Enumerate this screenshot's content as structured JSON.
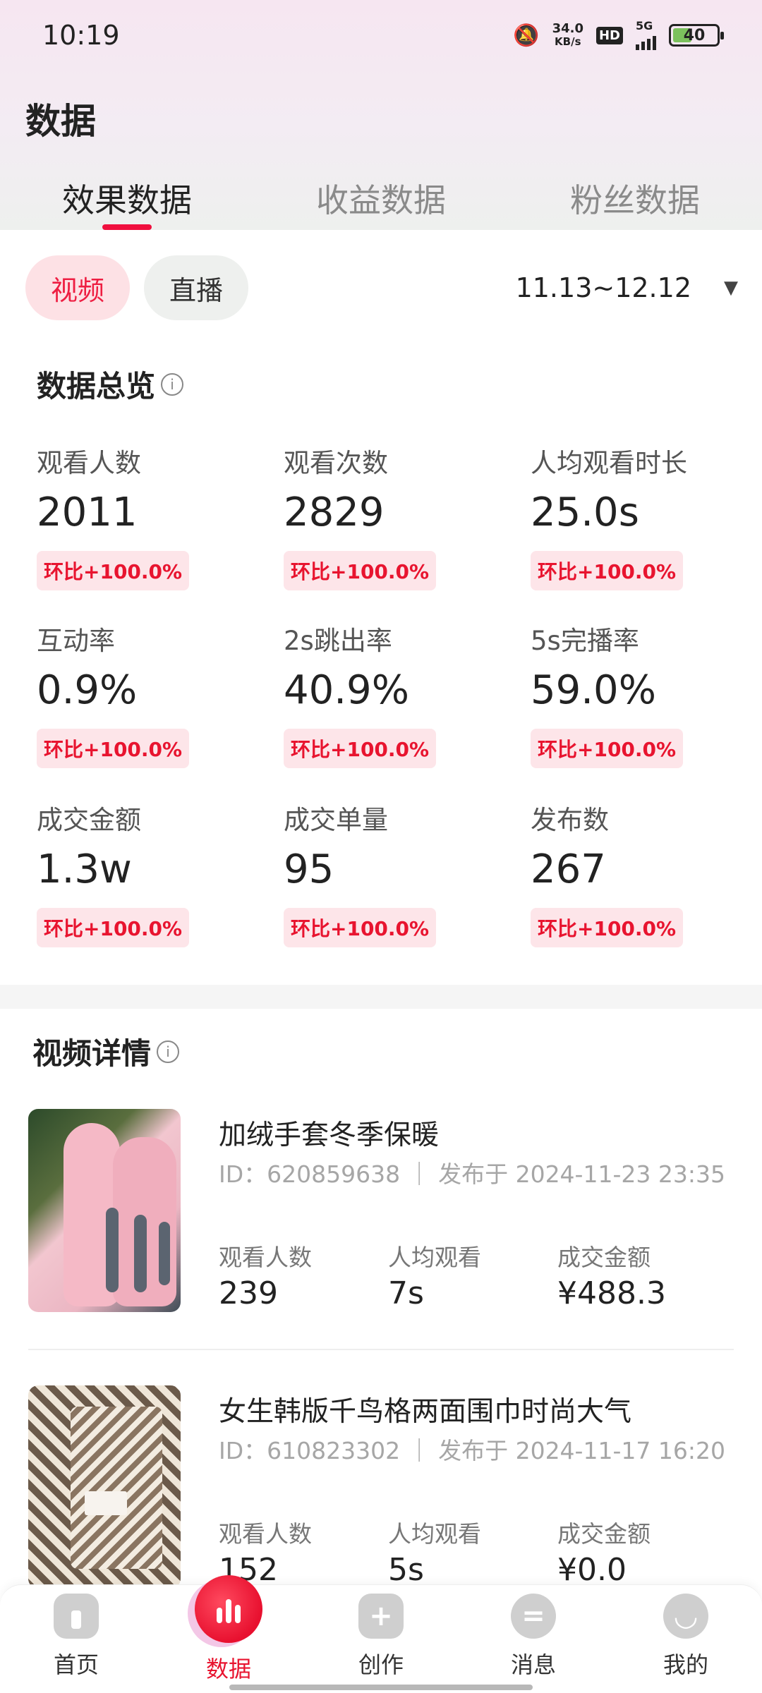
{
  "status_bar": {
    "time": "10:19",
    "net_speed_value": "34.0",
    "net_speed_unit": "KB/s",
    "hd": "HD",
    "network": "5G",
    "battery": "40"
  },
  "page": {
    "title": "数据"
  },
  "tabs": [
    {
      "label": "效果数据",
      "active": true
    },
    {
      "label": "收益数据",
      "active": false
    },
    {
      "label": "粉丝数据",
      "active": false
    }
  ],
  "filters": {
    "types": [
      {
        "label": "视频",
        "active": true
      },
      {
        "label": "直播",
        "active": false
      }
    ],
    "date_range": "11.13~12.12",
    "dropdown_icon": "▼"
  },
  "overview": {
    "title": "数据总览",
    "info_icon": "i",
    "metrics": [
      {
        "label": "观看人数",
        "value": "2011",
        "badge": "环比+100.0%"
      },
      {
        "label": "观看次数",
        "value": "2829",
        "badge": "环比+100.0%"
      },
      {
        "label": "人均观看时长",
        "value": "25.0s",
        "badge": "环比+100.0%"
      },
      {
        "label": "互动率",
        "value": "0.9%",
        "badge": "环比+100.0%"
      },
      {
        "label": "2s跳出率",
        "value": "40.9%",
        "badge": "环比+100.0%"
      },
      {
        "label": "5s完播率",
        "value": "59.0%",
        "badge": "环比+100.0%"
      },
      {
        "label": "成交金额",
        "value": "1.3w",
        "badge": "环比+100.0%"
      },
      {
        "label": "成交单量",
        "value": "95",
        "badge": "环比+100.0%"
      },
      {
        "label": "发布数",
        "value": "267",
        "badge": "环比+100.0%"
      }
    ]
  },
  "video_details": {
    "title": "视频详情",
    "info_icon": "i",
    "items": [
      {
        "title": "加绒手套冬季保暖",
        "meta": "ID：620859638 ｜ 发布于 2024-11-23 23:35",
        "stats": [
          {
            "label": "观看人数",
            "value": "239"
          },
          {
            "label": "人均观看",
            "value": "7s"
          },
          {
            "label": "成交金额",
            "value": "¥488.3"
          }
        ]
      },
      {
        "title": "女生韩版千鸟格两面围巾时尚大气",
        "meta": "ID：610823302 ｜ 发布于 2024-11-17 16:20",
        "stats": [
          {
            "label": "观看人数",
            "value": "152"
          },
          {
            "label": "人均观看",
            "value": "5s"
          },
          {
            "label": "成交金额",
            "value": "¥0.0"
          }
        ]
      }
    ]
  },
  "bottom_nav": [
    {
      "label": "首页",
      "icon": "home-icon",
      "active": false
    },
    {
      "label": "数据",
      "icon": "chart-icon",
      "active": true
    },
    {
      "label": "创作",
      "icon": "plus-icon",
      "glyph": "+",
      "active": false
    },
    {
      "label": "消息",
      "icon": "message-icon",
      "glyph": "=",
      "active": false
    },
    {
      "label": "我的",
      "icon": "profile-icon",
      "glyph": "◡",
      "active": false
    }
  ],
  "colors": {
    "accent": "#e8142f",
    "badge_bg": "#fde5e9",
    "pill_active_bg": "#fde1e5"
  }
}
